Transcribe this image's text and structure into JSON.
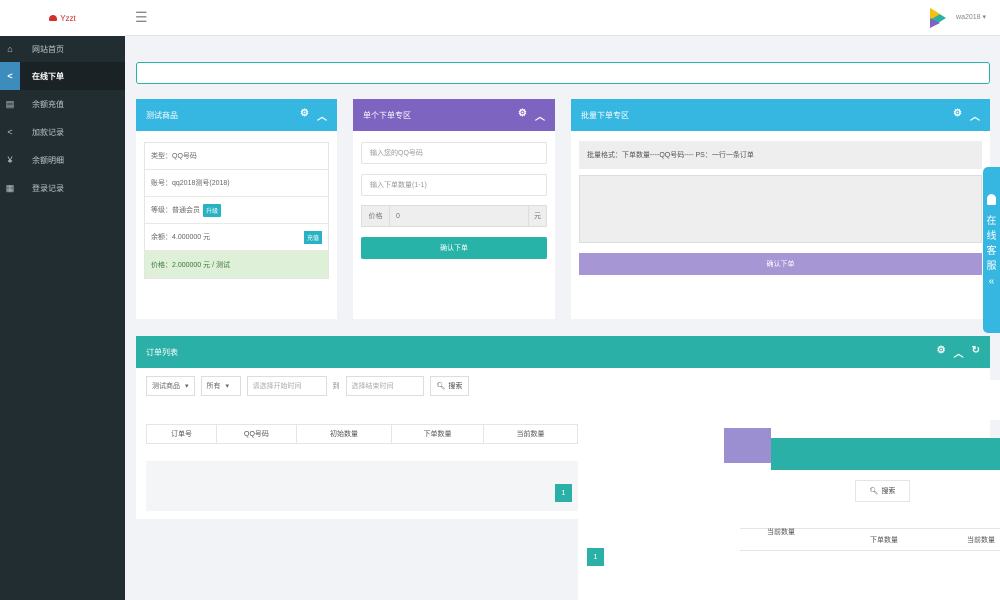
{
  "logo": {
    "text": "Yzzt"
  },
  "sidebar": {
    "items": [
      {
        "icon": "⌂",
        "label": "网站首页"
      },
      {
        "icon": "<",
        "label": "在线下单"
      },
      {
        "icon": "▤",
        "label": "余额充值"
      },
      {
        "icon": "<",
        "label": "加款记录"
      },
      {
        "icon": "¥",
        "label": "余额明细"
      },
      {
        "icon": "▦",
        "label": "登录记录"
      }
    ]
  },
  "topbar": {
    "menu_icon": "☰",
    "username": "wa2018 ▾"
  },
  "product_panel": {
    "title": "测试商品",
    "rows": {
      "type": "类型：QQ号码",
      "account": "账号：qq2018测号(2018)",
      "level": "等级：普通会员",
      "level_badge": "升级",
      "balance": "余额：4.000000 元",
      "balance_badge": "充值",
      "price": "价格：2.000000 元 / 测试"
    }
  },
  "single_order": {
    "title": "单个下单专区",
    "qq_placeholder": "输入您的QQ号码",
    "qty_placeholder": "输入下单数量(1-1)",
    "price_label": "价格",
    "price_value": "0",
    "price_unit": "元",
    "submit": "确认下单"
  },
  "batch_order": {
    "title": "批量下单专区",
    "hint": "批量格式：下单数量----QQ号码----    PS：一行一条订单",
    "submit": "确认下单"
  },
  "service_tab": {
    "text": [
      "在",
      "线",
      "客",
      "服",
      "«"
    ]
  },
  "order_list": {
    "title": "订单列表",
    "filter_product": "测试商品",
    "filter_status": "所有",
    "date_start": "请选择开始时间",
    "date_to": "到",
    "date_end": "选择结束时间",
    "search": "搜索",
    "columns": [
      "订单号",
      "QQ号码",
      "初始数量",
      "下单数量",
      "当前数量"
    ],
    "pager_1": "1",
    "pager_2": "1"
  },
  "glitch": {
    "search": "搜索",
    "col_current": "当前数量",
    "col_ordered": "下单数量",
    "col_current2": "当前数量"
  },
  "colors": {
    "sidebar": "#222d32",
    "blue": "#35b7e1",
    "purple": "#7e64c1",
    "teal": "#2ab0a6"
  }
}
